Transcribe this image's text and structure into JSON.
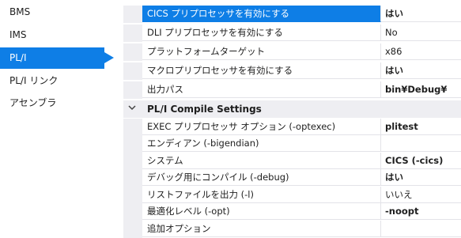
{
  "nav": {
    "items": [
      {
        "label": "BMS"
      },
      {
        "label": "IMS"
      },
      {
        "label": "PL/I"
      },
      {
        "label": "PL/I リンク"
      },
      {
        "label": "アセンブラ"
      }
    ],
    "selected": "PL/I"
  },
  "grid": {
    "rows": [
      {
        "name": "CICS プリプロセッサを有効にする",
        "value": "はい"
      },
      {
        "name": "DLI プリプロセッサを有効にする",
        "value": "No"
      },
      {
        "name": "プラットフォームターゲット",
        "value": "x86"
      },
      {
        "name": "マクロプリプロセッサを有効にする",
        "value": "はい"
      },
      {
        "name": "出力パス",
        "value": "bin¥Debug¥"
      }
    ],
    "category": {
      "label": "PL/I Compile Settings",
      "rows": [
        {
          "name": "EXEC プリプロセッサ オプション (-optexec)",
          "value": "plitest"
        },
        {
          "name": "エンディアン (-bigendian)",
          "value": ""
        },
        {
          "name": "システム",
          "value": "CICS (-cics)"
        },
        {
          "name": "デバッグ用にコンパイル (-debug)",
          "value": "はい"
        },
        {
          "name": "リストファイルを出力 (-l)",
          "value": "いいえ"
        },
        {
          "name": "最適化レベル (-opt)",
          "value": "-noopt"
        },
        {
          "name": "追加オプション",
          "value": ""
        }
      ]
    }
  },
  "icons": {
    "category_toggle": "chevron-down-icon"
  },
  "colors": {
    "selection": "#0e7ee6",
    "gutter": "#eeeef2"
  }
}
